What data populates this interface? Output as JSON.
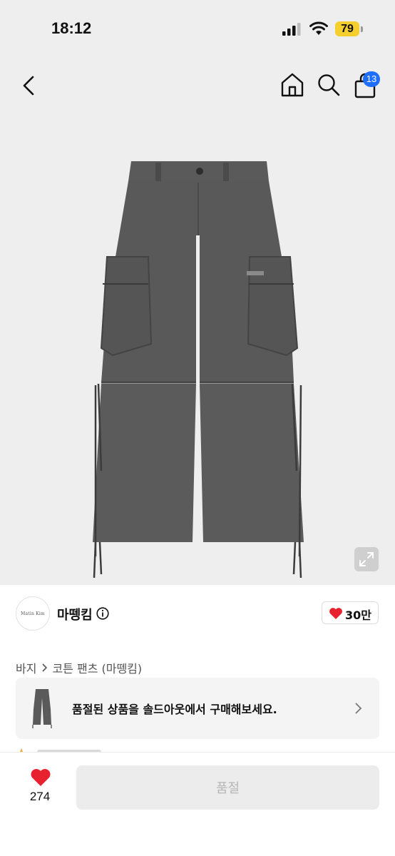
{
  "status_bar": {
    "time": "18:12",
    "battery": "79",
    "battery_color": "#f5cf2e"
  },
  "nav": {
    "back_icon": "chevron-left-icon",
    "home_icon": "home-icon",
    "search_icon": "search-icon",
    "cart_icon": "shopping-bag-icon",
    "cart_badge": "13",
    "badge_color": "#1f6fff"
  },
  "product": {
    "image_icon": "cargo-pants-image",
    "expand_icon": "expand-icon"
  },
  "brand": {
    "logo_text": "Matin Kim",
    "name": "마뗑킴",
    "info_icon": "info-circle-icon"
  },
  "likes": {
    "heart_icon": "heart-icon",
    "count": "30만",
    "heart_color": "#e8212e"
  },
  "breadcrumb": {
    "category": "바지",
    "product_name": "코튼 팬츠 (마뗑킴)"
  },
  "soldout_banner": {
    "text": "품절된 상품을 솔드아웃에서 구매해보세요."
  },
  "bottom_bar": {
    "like_count": "274",
    "buy_button_label": "품절"
  }
}
